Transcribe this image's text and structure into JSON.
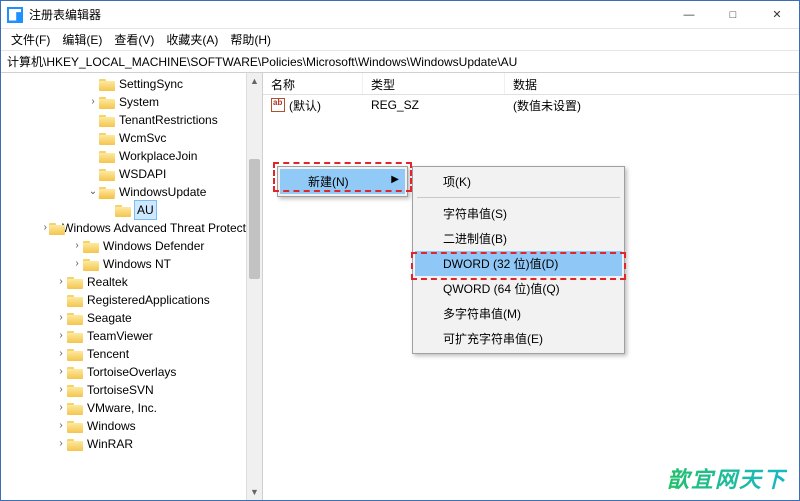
{
  "title": "注册表编辑器",
  "win_controls": {
    "min": "—",
    "max": "□",
    "close": "✕"
  },
  "menubar": [
    "文件(F)",
    "编辑(E)",
    "查看(V)",
    "收藏夹(A)",
    "帮助(H)"
  ],
  "path": "计算机\\HKEY_LOCAL_MACHINE\\SOFTWARE\\Policies\\Microsoft\\Windows\\WindowsUpdate\\AU",
  "tree": [
    {
      "depth": 5,
      "toggle": "",
      "label": "SettingSync"
    },
    {
      "depth": 5,
      "toggle": ">",
      "label": "System"
    },
    {
      "depth": 5,
      "toggle": "",
      "label": "TenantRestrictions"
    },
    {
      "depth": 5,
      "toggle": "",
      "label": "WcmSvc"
    },
    {
      "depth": 5,
      "toggle": "",
      "label": "WorkplaceJoin"
    },
    {
      "depth": 5,
      "toggle": "",
      "label": "WSDAPI"
    },
    {
      "depth": 5,
      "toggle": "v",
      "label": "WindowsUpdate",
      "open": true
    },
    {
      "depth": 6,
      "toggle": "",
      "label": "AU",
      "selected": true
    },
    {
      "depth": 4,
      "toggle": ">",
      "label": "Windows Advanced Threat Protection"
    },
    {
      "depth": 4,
      "toggle": ">",
      "label": "Windows Defender"
    },
    {
      "depth": 4,
      "toggle": ">",
      "label": "Windows NT"
    },
    {
      "depth": 3,
      "toggle": ">",
      "label": "Realtek"
    },
    {
      "depth": 3,
      "toggle": "",
      "label": "RegisteredApplications"
    },
    {
      "depth": 3,
      "toggle": ">",
      "label": "Seagate"
    },
    {
      "depth": 3,
      "toggle": ">",
      "label": "TeamViewer"
    },
    {
      "depth": 3,
      "toggle": ">",
      "label": "Tencent"
    },
    {
      "depth": 3,
      "toggle": ">",
      "label": "TortoiseOverlays"
    },
    {
      "depth": 3,
      "toggle": ">",
      "label": "TortoiseSVN"
    },
    {
      "depth": 3,
      "toggle": ">",
      "label": "VMware, Inc."
    },
    {
      "depth": 3,
      "toggle": ">",
      "label": "Windows"
    },
    {
      "depth": 3,
      "toggle": ">",
      "label": "WinRAR"
    }
  ],
  "columns": {
    "name": "名称",
    "type": "类型",
    "data": "数据"
  },
  "rows": [
    {
      "name": "(默认)",
      "type": "REG_SZ",
      "data": "(数值未设置)"
    }
  ],
  "context_primary": {
    "label": "新建(N)"
  },
  "context_sub": [
    {
      "label": "项(K)"
    },
    {
      "label": "字符串值(S)"
    },
    {
      "label": "二进制值(B)"
    },
    {
      "label": "DWORD (32 位)值(D)",
      "highlight": true
    },
    {
      "label": "QWORD (64 位)值(Q)"
    },
    {
      "label": "多字符串值(M)"
    },
    {
      "label": "可扩充字符串值(E)"
    }
  ],
  "watermark": "歆宜网天下"
}
